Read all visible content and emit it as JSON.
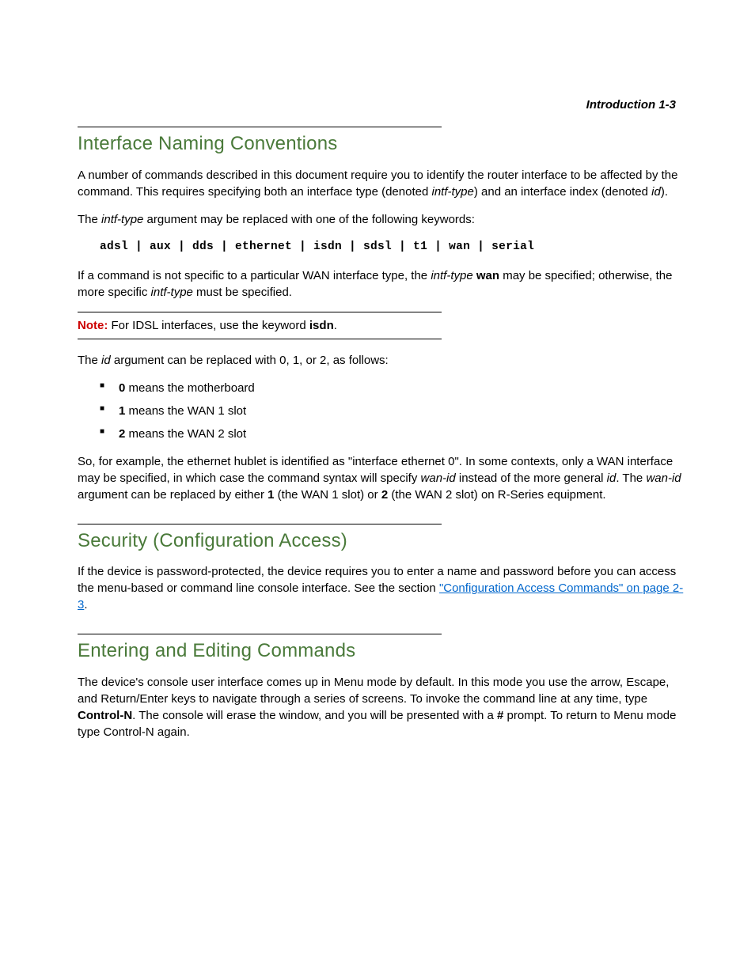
{
  "runningHead": "Introduction   1-3",
  "sec1": {
    "title": "Interface Naming Conventions",
    "p1a": "A number of commands described in this document require you to identify the router interface to be affected by the command. This requires specifying both an interface type (denoted ",
    "p1b": "intf-type",
    "p1c": ") and an interface index (denoted ",
    "p1d": "id",
    "p1e": ").",
    "p2a": "The ",
    "p2b": "intf-type",
    "p2c": " argument may be replaced with one of the following keywords:",
    "keywords": "adsl | aux | dds | ethernet | isdn | sdsl | t1 | wan | serial",
    "p3a": "If a command is not specific to a particular WAN interface type, the ",
    "p3b": "intf-type",
    "p3c": " ",
    "p3d": "wan",
    "p3e": " may be specified; otherwise, the more specific ",
    "p3f": "intf-type",
    "p3g": " must be specified.",
    "noteLabel": "Note:",
    "noteA": "  For IDSL interfaces, use the keyword ",
    "noteB": "isdn",
    "noteC": ".",
    "p4a": "The ",
    "p4b": "id",
    "p4c": " argument can be replaced with 0, 1, or 2, as follows:",
    "li1a": "0",
    "li1b": " means the motherboard",
    "li2a": "1",
    "li2b": " means the WAN 1 slot",
    "li3a": "2",
    "li3b": " means the WAN 2 slot",
    "p5a": "So, for example, the ethernet hublet is identified as \"interface ethernet 0\". In some contexts, only a WAN interface may be specified, in which case the command syntax will specify ",
    "p5b": "wan-id",
    "p5c": " instead of the more general ",
    "p5d": "id",
    "p5e": ". The ",
    "p5f": "wan-id",
    "p5g": " argument can be replaced by either ",
    "p5h": "1",
    "p5i": " (the WAN 1 slot) or ",
    "p5j": "2",
    "p5k": " (the WAN 2 slot) on R-Series equipment."
  },
  "sec2": {
    "title": "Security (Configuration Access)",
    "p1a": "If the device is password-protected, the device requires you to enter a name and password before you can access the menu-based or command line console interface. See the section ",
    "link": "\"Configuration Access Commands\" on page 2-3",
    "p1b": "."
  },
  "sec3": {
    "title": "Entering and Editing Commands",
    "p1a": "The device's console user interface comes up in Menu mode by default. In this mode you use the arrow, Escape, and Return/Enter keys to navigate through a series of screens. To invoke the command line at any time, type ",
    "p1b": "Control-N",
    "p1c": ". The console will erase the window, and you will be presented with a ",
    "p1d": "#",
    "p1e": " prompt. To return to Menu mode type Control-N again."
  }
}
